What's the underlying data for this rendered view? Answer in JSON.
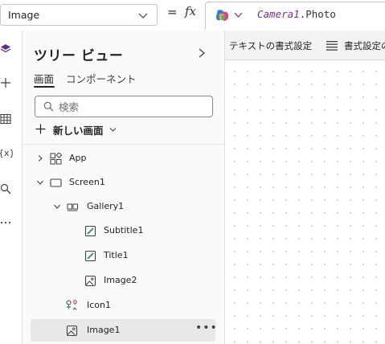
{
  "formula_bar": {
    "property": "Image",
    "equals": "=",
    "fx": "fx",
    "formula_identifier": "Camera1",
    "formula_property": ".Photo"
  },
  "format_toolbar": {
    "format_text_label": "テキストの書式設定",
    "format_settings_label": "書式設定の"
  },
  "tree_view": {
    "title": "ツリー ビュー",
    "tabs": [
      "画面",
      "コンポーネント"
    ],
    "search_placeholder": "検索",
    "new_screen_label": "新しい画面",
    "items": [
      {
        "label": "App",
        "icon": "app-icon"
      },
      {
        "label": "Screen1",
        "icon": "screen-icon"
      },
      {
        "label": "Gallery1",
        "icon": "gallery-icon"
      },
      {
        "label": "Subtitle1",
        "icon": "label-edit-icon"
      },
      {
        "label": "Title1",
        "icon": "label-edit-icon"
      },
      {
        "label": "Image2",
        "icon": "image-icon"
      },
      {
        "label": "Icon1",
        "icon": "icons-control-icon"
      },
      {
        "label": "Image1",
        "icon": "image-icon",
        "selected": true
      }
    ]
  },
  "left_rail": [
    "layers-icon",
    "insert-icon",
    "data-icon",
    "variables-icon",
    "search-icon",
    "more-icon"
  ],
  "colors": {
    "accent": "#7a2e8f",
    "selected_row": "#e8e8e8",
    "panel_bg": "#fafafa"
  }
}
